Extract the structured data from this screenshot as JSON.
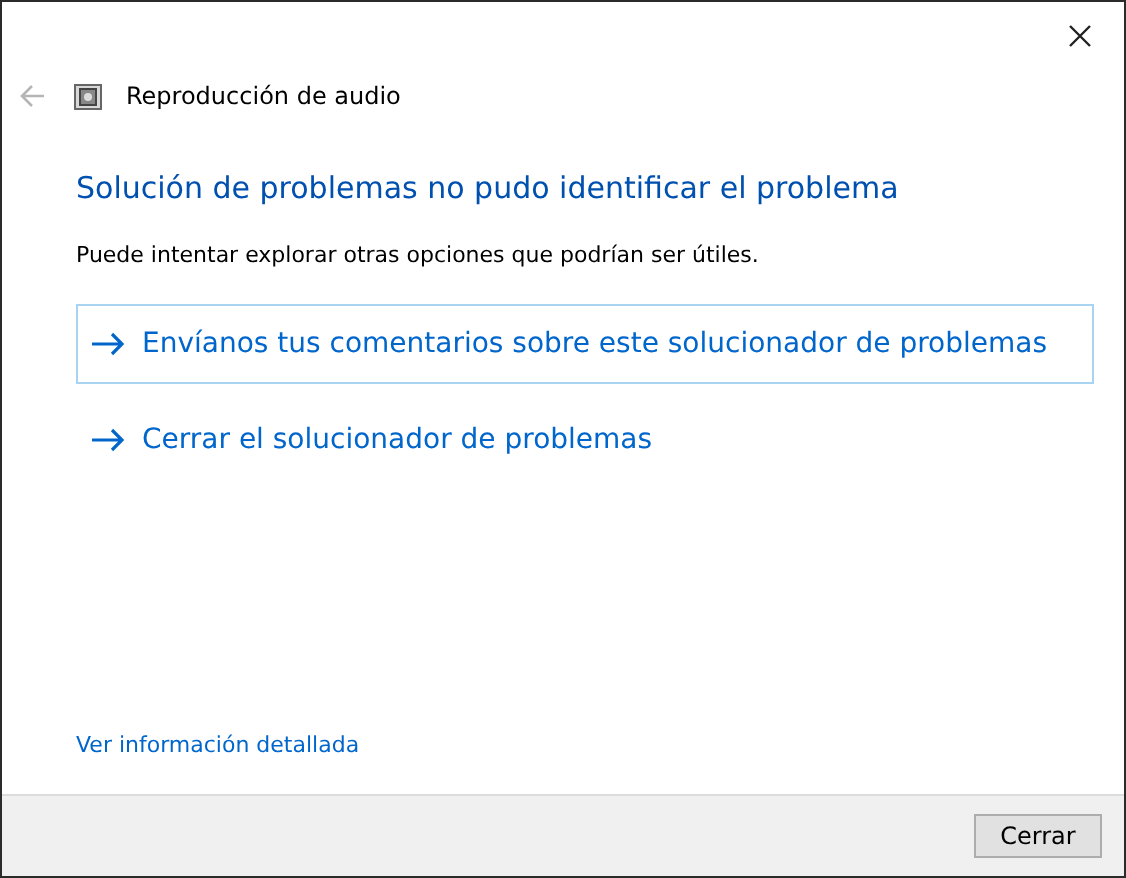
{
  "window": {
    "title": "Reproducción de audio"
  },
  "heading": "Solución de problemas no pudo identificar el problema",
  "description": "Puede intentar explorar otras opciones que podrían ser útiles.",
  "options": [
    {
      "label": "Envíanos tus comentarios sobre este solucionador de problemas",
      "selected": true
    },
    {
      "label": "Cerrar el solucionador de problemas",
      "selected": false
    }
  ],
  "details_link": "Ver información detallada",
  "buttons": [
    "Cerrar"
  ]
}
